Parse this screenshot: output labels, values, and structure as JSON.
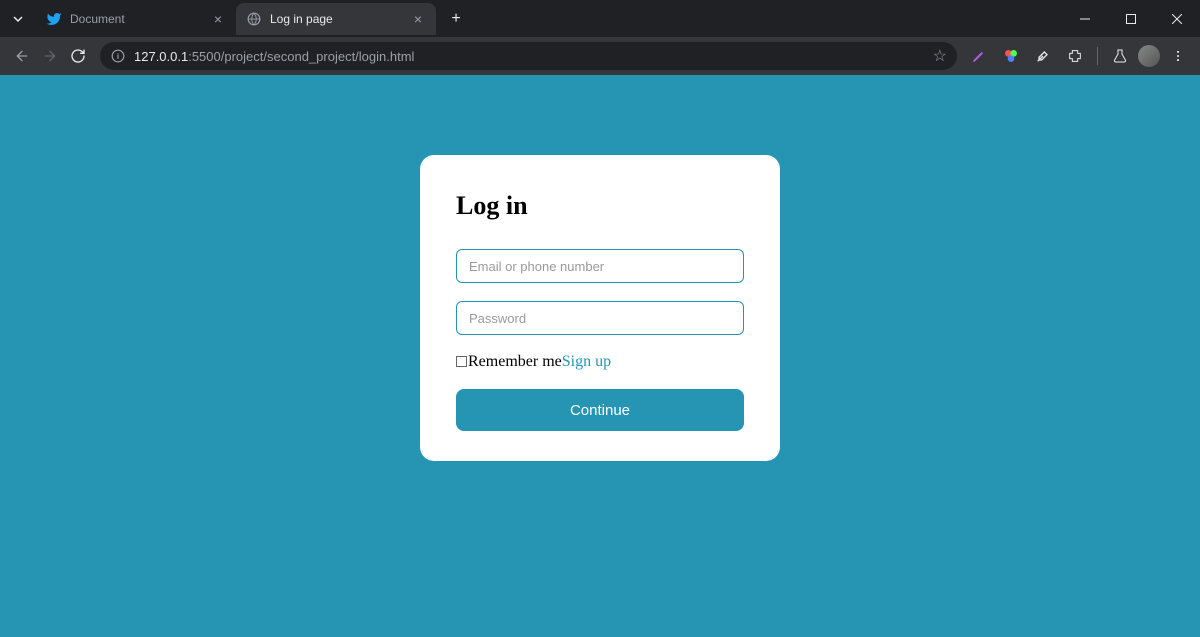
{
  "browser": {
    "tabs": [
      {
        "title": "Document",
        "icon": "twitter"
      },
      {
        "title": "Log in page",
        "icon": "globe"
      }
    ],
    "url": {
      "host": "127.0.0.1",
      "port": ":5500",
      "path": "/project/second_project/login.html"
    }
  },
  "login": {
    "title": "Log in",
    "email_placeholder": "Email or phone number",
    "password_placeholder": "Password",
    "remember_label": "Remember me",
    "signup_label": "Sign up",
    "continue_label": "Continue"
  }
}
